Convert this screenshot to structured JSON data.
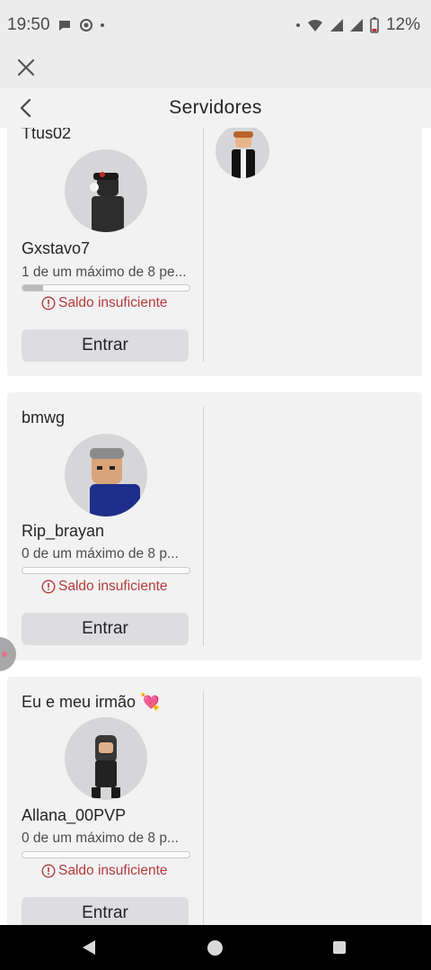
{
  "status_bar": {
    "time": "19:50",
    "battery": "12%",
    "icons": [
      "message-icon",
      "record-icon",
      "wifi-icon",
      "signal-icon",
      "signal-icon",
      "battery-icon"
    ]
  },
  "header": {
    "title": "Servidores"
  },
  "servers": [
    {
      "name": "Ttus02",
      "player": "Gxstavo7",
      "capacity": "1 de um máximo de 8 pe...",
      "fill": 0.125,
      "warning": "Saldo insuficiente",
      "button": "Entrar"
    },
    {
      "name": "bmwg",
      "player": "Rip_brayan",
      "capacity": "0 de um máximo de 8 p...",
      "fill": 0,
      "warning": "Saldo insuficiente",
      "button": "Entrar"
    },
    {
      "name": "Eu e meu irmão 💘",
      "player": "Allana_00PVP",
      "capacity": "0 de um máximo de 8 p...",
      "fill": 0,
      "warning": "Saldo insuficiente",
      "button": "Entrar"
    }
  ],
  "colors": {
    "warning": "#b33a3a",
    "card_bg": "#f2f2f3",
    "button_bg": "#dddde0"
  }
}
